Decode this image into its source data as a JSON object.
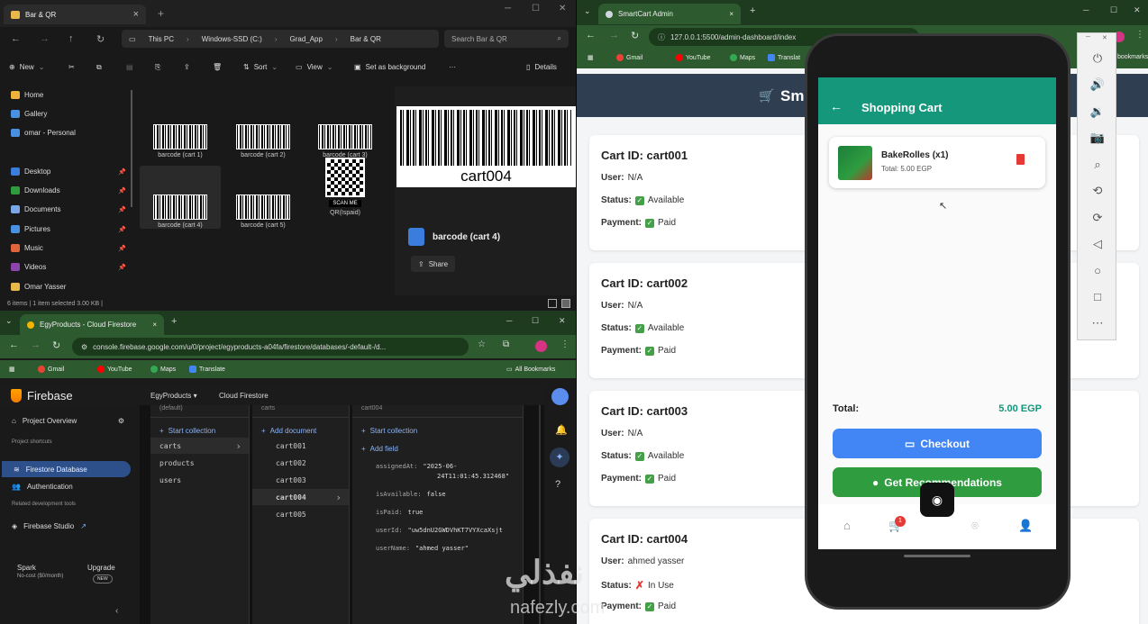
{
  "explorer": {
    "tab_title": "Bar & QR",
    "path": [
      "This PC",
      "Windows-SSD (C:)",
      "Grad_App",
      "Bar & QR"
    ],
    "search_placeholder": "Search Bar & QR",
    "cmd": {
      "new": "New",
      "sort": "Sort",
      "view": "View",
      "set_bg": "Set as background",
      "more": "···",
      "details": "Details"
    },
    "sidebar": [
      {
        "label": "Home",
        "pin": false
      },
      {
        "label": "Gallery",
        "pin": false
      },
      {
        "label": "omar - Personal",
        "pin": false
      },
      {
        "label": "Desktop",
        "pin": true
      },
      {
        "label": "Downloads",
        "pin": true
      },
      {
        "label": "Documents",
        "pin": true
      },
      {
        "label": "Pictures",
        "pin": true
      },
      {
        "label": "Music",
        "pin": true
      },
      {
        "label": "Videos",
        "pin": true
      },
      {
        "label": "Omar Yasser",
        "pin": false
      }
    ],
    "files": [
      {
        "name": "barcode (cart 1)",
        "kind": "barcode"
      },
      {
        "name": "barcode (cart 2)",
        "kind": "barcode"
      },
      {
        "name": "barcode (cart 3)",
        "kind": "barcode"
      },
      {
        "name": "barcode (cart 4)",
        "kind": "barcode"
      },
      {
        "name": "barcode (cart 5)",
        "kind": "barcode"
      },
      {
        "name": "QR(Ispaid)",
        "kind": "qr"
      }
    ],
    "qr_caption": "SCAN ME",
    "preview_barcode_label": "cart004",
    "preview_name": "barcode (cart 4)",
    "share": "Share",
    "status": "6 items  |  1 item selected  3.00 KB  |"
  },
  "firebase_window": {
    "tab_title": "EgyProducts - Cloud Firestore",
    "url": "console.firebase.google.com/u/0/project/egyproducts-a04fa/firestore/databases/-default-/d...",
    "bookmarks": [
      "Gmail",
      "YouTube",
      "Maps",
      "Translate"
    ],
    "all_bookmarks": "All Bookmarks",
    "brand": "Firebase",
    "project": "EgyProducts",
    "product": "Cloud Firestore",
    "nav": {
      "overview": "Project Overview",
      "shortcuts": "Project shortcuts",
      "firestore": "Firestore Database",
      "auth": "Authentication",
      "related": "Related development tools",
      "studio": "Firebase Studio",
      "plan": "Spark",
      "plan_sub": "No-cost ($0/month)",
      "upgrade": "Upgrade",
      "new_badge": "NEW"
    },
    "col1": {
      "head": "(default)",
      "add": "Start collection",
      "items": [
        "carts",
        "products",
        "users"
      ]
    },
    "col2": {
      "head": "carts",
      "add": "Add document",
      "items": [
        "cart001",
        "cart002",
        "cart003",
        "cart004",
        "cart005"
      ]
    },
    "col3": {
      "head": "cart004",
      "add_collection": "Start collection",
      "add_field": "Add field",
      "fields": [
        {
          "k": "assignedAt:",
          "v": "\"2025-06-"
        },
        {
          "k": "",
          "v": "24T11:01:45.312468\""
        },
        {
          "k": "isAvailable:",
          "v": "false"
        },
        {
          "k": "isPaid:",
          "v": "true"
        },
        {
          "k": "userId:",
          "v": "\"uw5dnU2GWDVhKT7VYXcaXsjt"
        },
        {
          "k": "userName:",
          "v": "\"ahmed yasser\""
        }
      ]
    }
  },
  "admin_window": {
    "tab_title": "SmartCart Admin",
    "url": "127.0.0.1:5500/admin-dashboard/index",
    "bookmarks": [
      "Gmail",
      "YouTube",
      "Maps",
      "Translat"
    ],
    "bookmarks_right": "bookmarks",
    "header_title": "Smart",
    "carts": [
      {
        "id": "Cart ID: cart001",
        "user": "N/A",
        "status": "Available",
        "status_ok": true,
        "payment": "Paid"
      },
      {
        "id": "Cart ID: cart002",
        "user": "N/A",
        "status": "Available",
        "status_ok": true,
        "payment": "Paid"
      },
      {
        "id": "Cart ID: cart003",
        "user": "N/A",
        "status": "Available",
        "status_ok": true,
        "payment": "Paid"
      },
      {
        "id": "Cart ID: cart004",
        "user": "ahmed yasser",
        "status": "In Use",
        "status_ok": false,
        "payment": "Paid"
      }
    ],
    "labels": {
      "user": "User:",
      "status": "Status:",
      "payment": "Payment:"
    }
  },
  "phone_app": {
    "title": "Shopping Cart",
    "item": {
      "name": "BakeRolles (x1)",
      "total": "Total: 5.00 EGP"
    },
    "total_label": "Total:",
    "total_value": "5.00 EGP",
    "checkout": "Checkout",
    "recommend": "Get Recommendations",
    "cart_badge": "1",
    "colors": {
      "primary": "#15977b",
      "checkout": "#4285f4",
      "recommend": "#2e9c3f"
    }
  },
  "watermark": {
    "arabic": "نفذلي",
    "latin": "nafezly.com"
  }
}
